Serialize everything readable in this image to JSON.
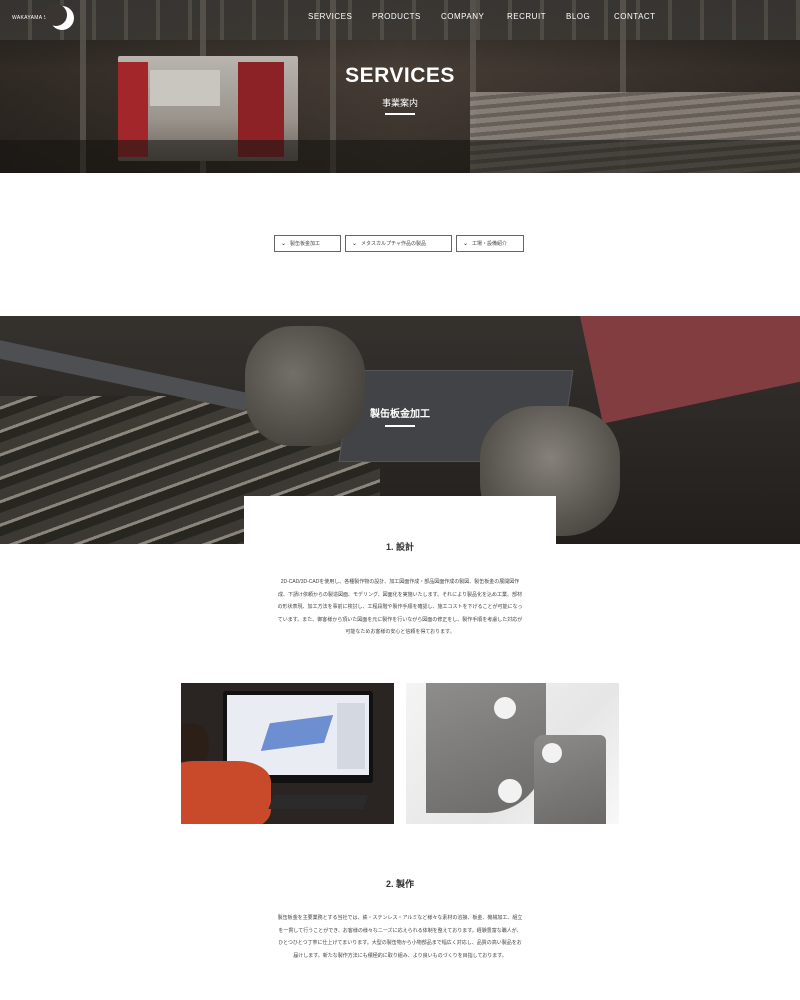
{
  "header": {
    "logo_text": "WAKAYAMA SEN",
    "nav": [
      "SERVICES",
      "PRODUCTS",
      "COMPANY",
      "RECRUIT",
      "BLOG",
      "CONTACT"
    ]
  },
  "hero": {
    "title": "SERVICES",
    "subtitle": "事業案内"
  },
  "anchors": [
    "製缶板金加工",
    "メタスカルプチャ作品の製品",
    "工場・設備紹介"
  ],
  "section1": {
    "title": "製缶板金加工"
  },
  "step1": {
    "title": "1. 設計",
    "body": "2D-CAD/3D-CADを使用し、各種製作物の設計、加工図面作成・部品図面作成の製図、製缶板金の展開図作成、下請け依頼からの製造図面、モデリング、図面化を実施いたします。それにより製品化を込め工業、部材の形状表現、加工方法を事前に検討し、工程段階や製作手順を確認し、施工コストを下げることが可能になっています。また、御客様から頂いた図面を元に製作を行いながら図面の修正をし、製作手順を考慮した対応が可能なためお客様の安心と信頼を得ております。"
  },
  "step2": {
    "title": "2. 製作",
    "body": "製缶板金を主要業務とする当社では、鉄・ステンレス・アルミなど様々な素材の溶接、板金、機械加工、組立を一貫して行うことができ、お客様の様々なニーズに応えられる体制を整えております。経験豊富な職人が、ひとつひとつ丁寧に仕上げてまいります。大型の製缶物から小物部品まで幅広く対応し、品質の高い製品をお届けします。新たな製作方法にも積極的に取り組み、より良いものづくりを目指しております。"
  },
  "icons": {
    "nav_chevron": "chevron-down-icon"
  }
}
